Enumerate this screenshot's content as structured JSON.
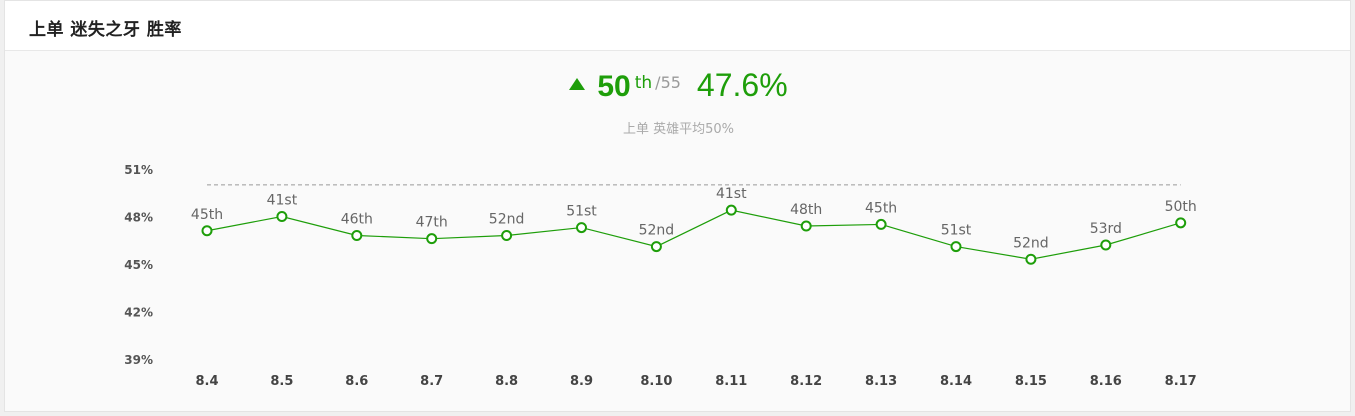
{
  "header": {
    "title": "上单 迷失之牙 胜率"
  },
  "summary": {
    "rank": "50",
    "rank_suffix": "th",
    "rank_total": "/55",
    "win_rate": "47.6%",
    "average_note": "上单 英雄平均50%"
  },
  "colors": {
    "accent": "#1e9e0a",
    "reference_line": "#999999"
  },
  "icons": {
    "trend": "triangle-up-icon"
  },
  "chart_data": {
    "type": "line",
    "categories": [
      "8.4",
      "8.5",
      "8.6",
      "8.7",
      "8.8",
      "8.9",
      "8.10",
      "8.11",
      "8.12",
      "8.13",
      "8.14",
      "8.15",
      "8.16",
      "8.17"
    ],
    "values": [
      47.1,
      48.0,
      46.8,
      46.6,
      46.8,
      47.3,
      46.1,
      48.4,
      47.4,
      47.5,
      46.1,
      45.3,
      46.2,
      47.6
    ],
    "rank_labels": [
      "45th",
      "41st",
      "46th",
      "47th",
      "52nd",
      "51st",
      "52nd",
      "41st",
      "48th",
      "45th",
      "51st",
      "52nd",
      "53rd",
      "50th"
    ],
    "yticks": [
      "51%",
      "48%",
      "45%",
      "42%",
      "39%"
    ],
    "ytick_values": [
      51,
      48,
      45,
      42,
      39
    ],
    "ylim": [
      39,
      51
    ],
    "reference_value": 50,
    "grid": false,
    "legend": "none"
  }
}
